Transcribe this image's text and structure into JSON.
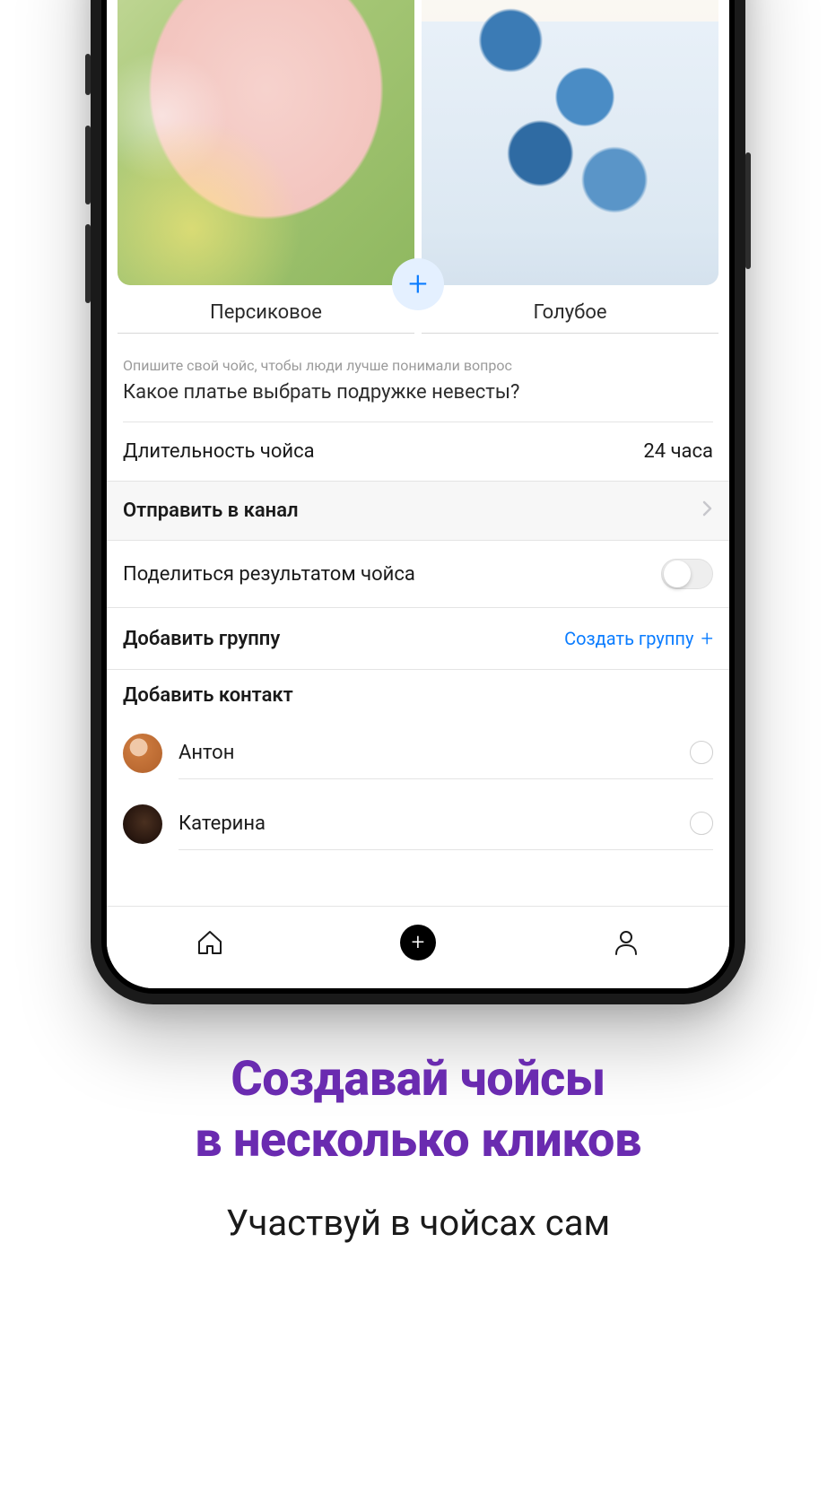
{
  "options": {
    "left_label": "Персиковое",
    "right_label": "Голубое"
  },
  "hint": "Опишите свой чойс, чтобы люди лучше понимали вопрос",
  "question": "Какое платье выбрать подружке невесты?",
  "duration": {
    "label": "Длительность чойса",
    "value": "24 часа"
  },
  "send_channel": {
    "label": "Отправить в канал"
  },
  "share_result": {
    "label": "Поделиться результатом чойса"
  },
  "add_group": {
    "label": "Добавить группу",
    "create_label": "Создать группу"
  },
  "add_contact_header": "Добавить контакт",
  "contacts": [
    {
      "name": "Антон"
    },
    {
      "name": "Катерина"
    }
  ],
  "promo": {
    "headline_l1": "Создавай чойсы",
    "headline_l2": "в несколько кликов",
    "subline": "Участвуй в чойсах сам"
  },
  "colors": {
    "accent": "#6a2bb0",
    "link": "#0a7cff"
  }
}
